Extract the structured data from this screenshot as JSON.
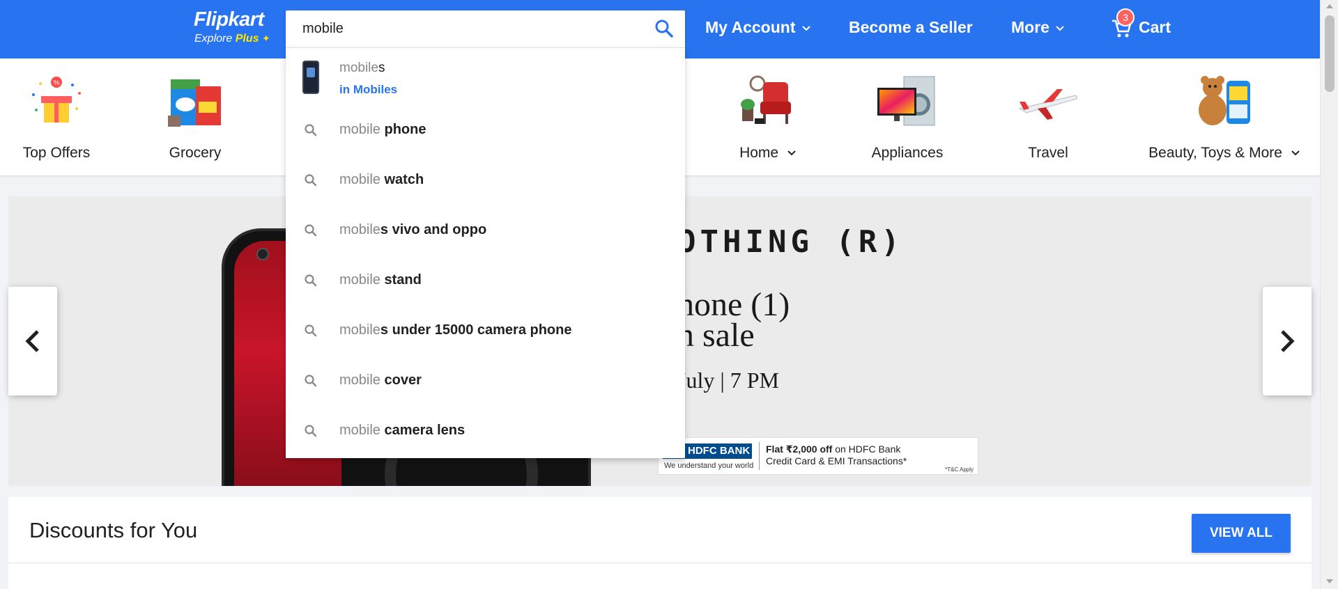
{
  "header": {
    "logo": {
      "main": "Flipkart",
      "sub_prefix": "Explore",
      "sub_plus": "Plus"
    },
    "search": {
      "value": "mobile"
    },
    "nav": {
      "account": "My Account",
      "seller": "Become a Seller",
      "more": "More",
      "cart": "Cart",
      "cart_count": "3"
    },
    "colors": {
      "brand": "#2874f0",
      "plus": "#ffe500",
      "badge": "#ff6161"
    }
  },
  "suggestions": {
    "query": "mobile",
    "top": {
      "query_part": "mobile",
      "rest": "s",
      "category": "in Mobiles"
    },
    "items": [
      {
        "query_part": "mobile",
        "rest": " phone"
      },
      {
        "query_part": "mobile",
        "rest": " watch"
      },
      {
        "query_part": "mobile",
        "rest": "s vivo and oppo"
      },
      {
        "query_part": "mobile",
        "rest": " stand"
      },
      {
        "query_part": "mobile",
        "rest": "s under 15000 camera phone"
      },
      {
        "query_part": "mobile",
        "rest": " cover"
      },
      {
        "query_part": "mobile",
        "rest": " camera lens"
      }
    ]
  },
  "categories": [
    {
      "label": "Top Offers",
      "icon": "gift-box-icon"
    },
    {
      "label": "Grocery",
      "icon": "grocery-icon"
    },
    {
      "label": "Home",
      "icon": "armchair-icon",
      "has_dropdown": true
    },
    {
      "label": "Appliances",
      "icon": "washing-machine-icon"
    },
    {
      "label": "Travel",
      "icon": "airplane-icon"
    },
    {
      "label": "Beauty, Toys & More",
      "icon": "teddy-bear-icon",
      "has_dropdown": true
    }
  ],
  "banner": {
    "brand": "OTHING (R)",
    "line1": "hone (1)",
    "line2": "n sale",
    "line3": "July | 7 PM",
    "bank": {
      "name": "HDFC BANK",
      "tagline": "We understand your world",
      "offer_bold": "Flat ₹2,000 off",
      "offer_rest": " on HDFC Bank",
      "offer_line2": "Credit Card & EMI Transactions*",
      "tnc": "*T&C Apply"
    }
  },
  "discounts": {
    "title": "Discounts for You",
    "view_all": "VIEW ALL"
  }
}
